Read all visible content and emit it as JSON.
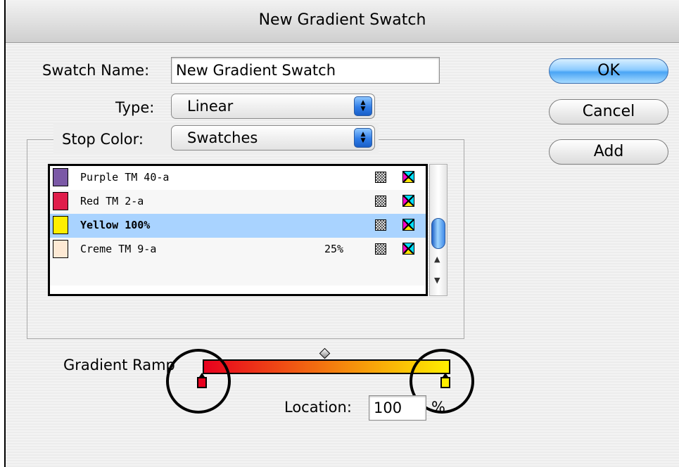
{
  "dialog": {
    "title": "New Gradient Swatch"
  },
  "swatch_name": {
    "label": "Swatch Name:",
    "value": "New Gradient Swatch"
  },
  "type": {
    "label": "Type:",
    "selected": "Linear"
  },
  "stop_color": {
    "label": "Stop Color:",
    "selected": "Swatches"
  },
  "buttons": {
    "ok": "OK",
    "cancel": "Cancel",
    "add": "Add"
  },
  "swatches": [
    {
      "name": "Purple TM 40-a",
      "tint": "",
      "color": "#7b59a6",
      "selected": false
    },
    {
      "name": "Red TM 2-a",
      "tint": "",
      "color": "#e01e4b",
      "selected": false
    },
    {
      "name": "Yellow 100%",
      "tint": "",
      "color": "#ffee00",
      "selected": true
    },
    {
      "name": "Creme TM 9-a",
      "tint": "25%",
      "color": "#fde9d4",
      "selected": false
    }
  ],
  "gradient_ramp": {
    "label": "Gradient Ramp",
    "start_color": "#e8001e",
    "end_color": "#ffee00"
  },
  "location": {
    "label": "Location:",
    "value": "100",
    "unit": "%"
  },
  "icons": {
    "process": "process-color-icon",
    "cmyk": "cmyk-mode-icon"
  }
}
